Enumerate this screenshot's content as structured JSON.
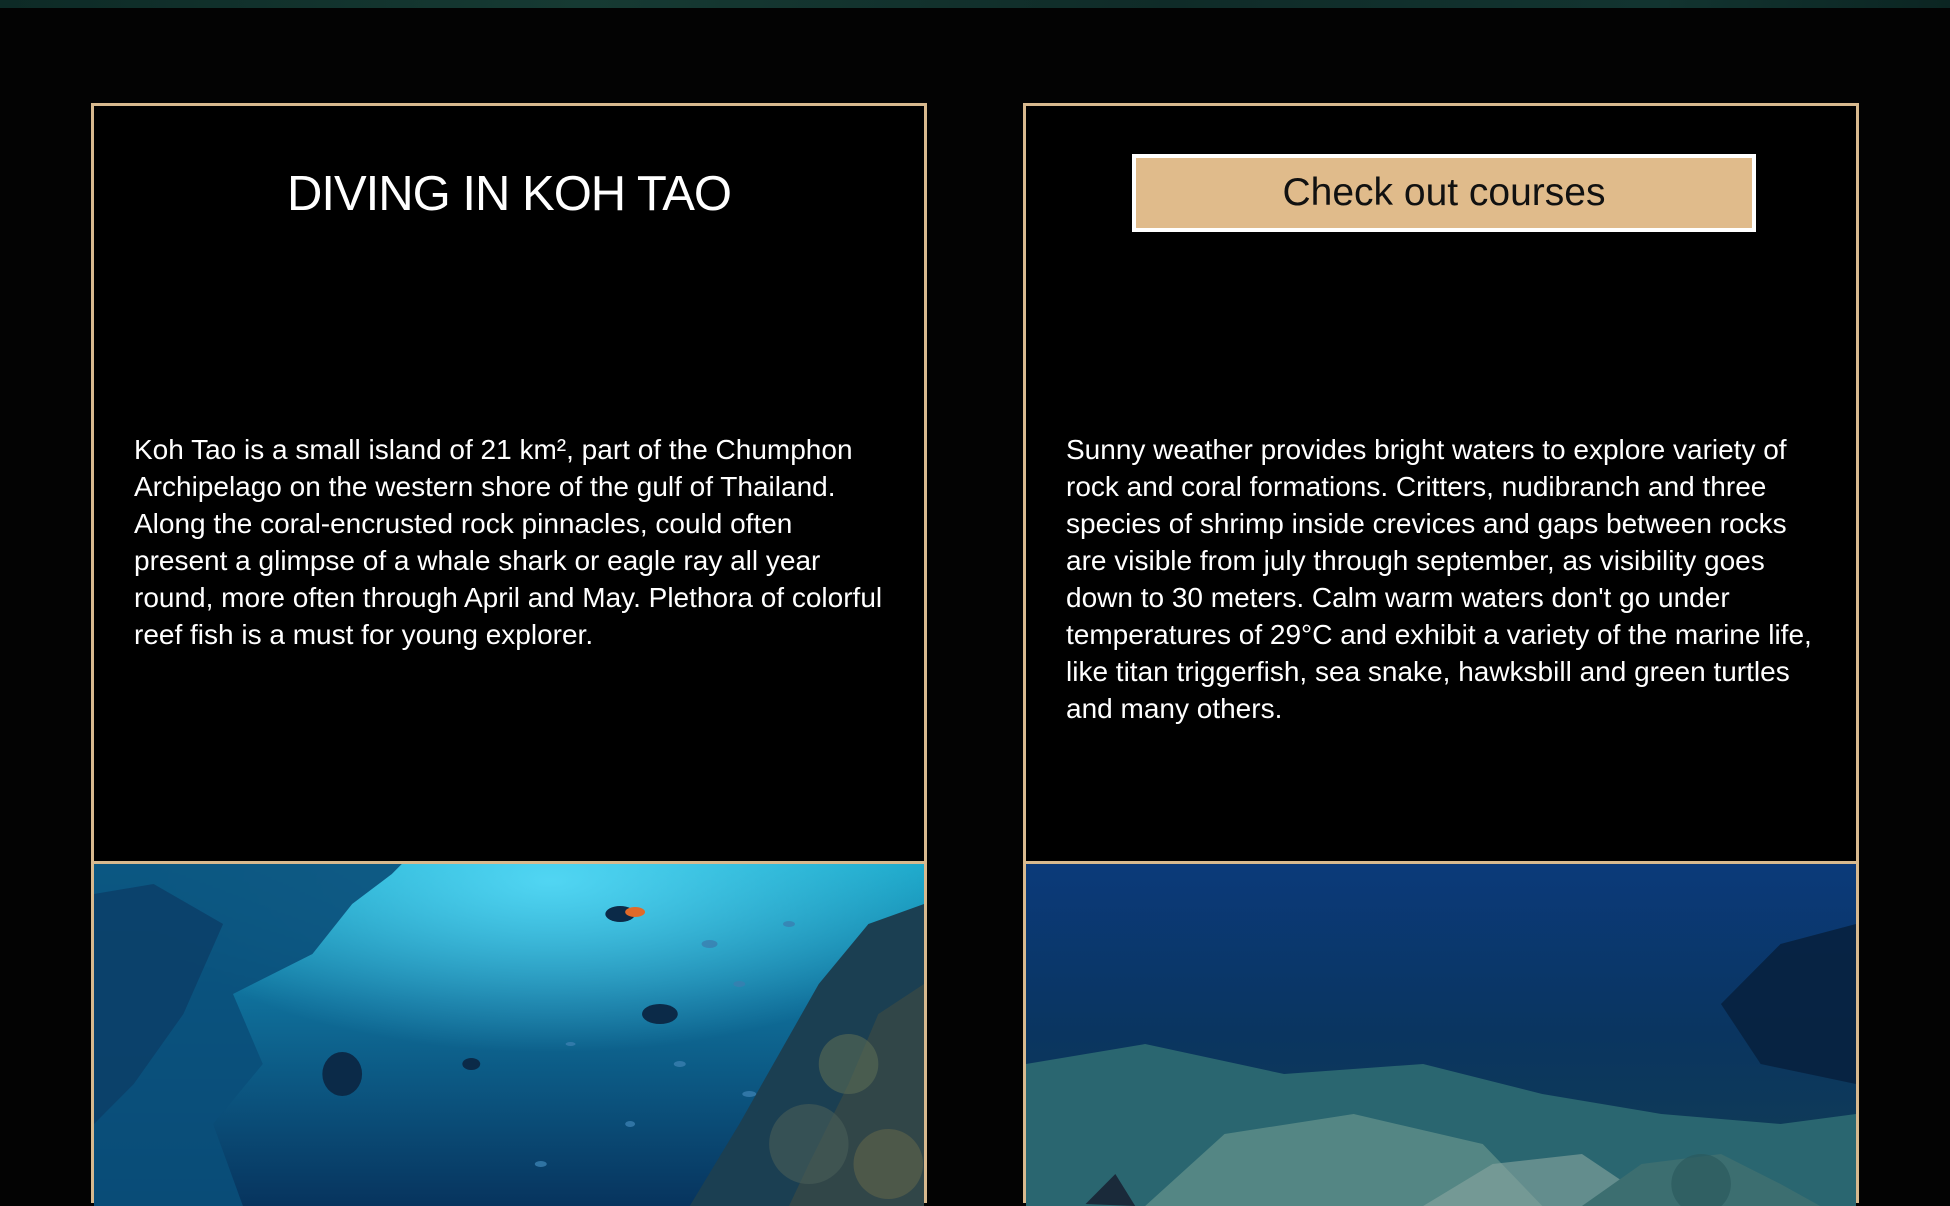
{
  "cards": [
    {
      "title": "DIVING IN KOH TAO",
      "body": "Koh Tao is a small island of 21 km², part of the Chumphon Archipelago on the western shore of the gulf of Thailand. Along the coral-encrusted rock pinnacles, could often present a glimpse of a whale shark or eagle ray all year round, more often through April and May. Plethora of colorful reef fish is a must for young explorer."
    },
    {
      "button_label": "Check out courses",
      "body": "Sunny weather provides bright waters to explore variety of rock and coral formations. Critters, nudibranch and three species of shrimp inside crevices and gaps between rocks are visible from july through september, as visibility goes down to 30 meters. Calm warm waters don't go under temperatures of 29°C and exhibit a variety of the marine life, like titan triggerfish, sea snake, hawksbill and green turtles and many others."
    }
  ],
  "colors": {
    "background": "#030303",
    "border_gold": "#d8b98e",
    "button_fill": "#e0bb8b",
    "text": "#ffffff"
  }
}
